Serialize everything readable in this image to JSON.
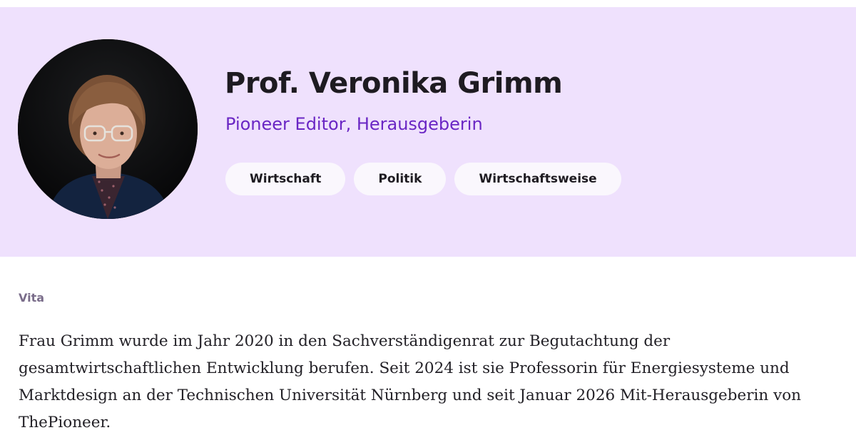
{
  "profile": {
    "name": "Prof. Veronika Grimm",
    "role": "Pioneer Editor, Herausgeberin",
    "avatar_icon": "portrait-photo",
    "tags": [
      "Wirtschaft",
      "Politik",
      "Wirtschaftsweise"
    ]
  },
  "vita": {
    "label": "Vita",
    "text": "Frau Grimm wurde im Jahr 2020 in den Sachverständigenrat zur Begutachtung der gesamtwirtschaftlichen Entwicklung berufen. Seit 2024 ist sie Professorin für Energiesysteme und Marktdesign an der Technischen Universität Nürnberg und seit Januar 2026 Mit-Herausgeberin von ThePioneer."
  },
  "colors": {
    "hero_background": "#efe1fd",
    "accent": "#6a26c4",
    "tag_background": "#faf7fd",
    "text": "#1e1b21",
    "muted": "#7a6d8a"
  }
}
